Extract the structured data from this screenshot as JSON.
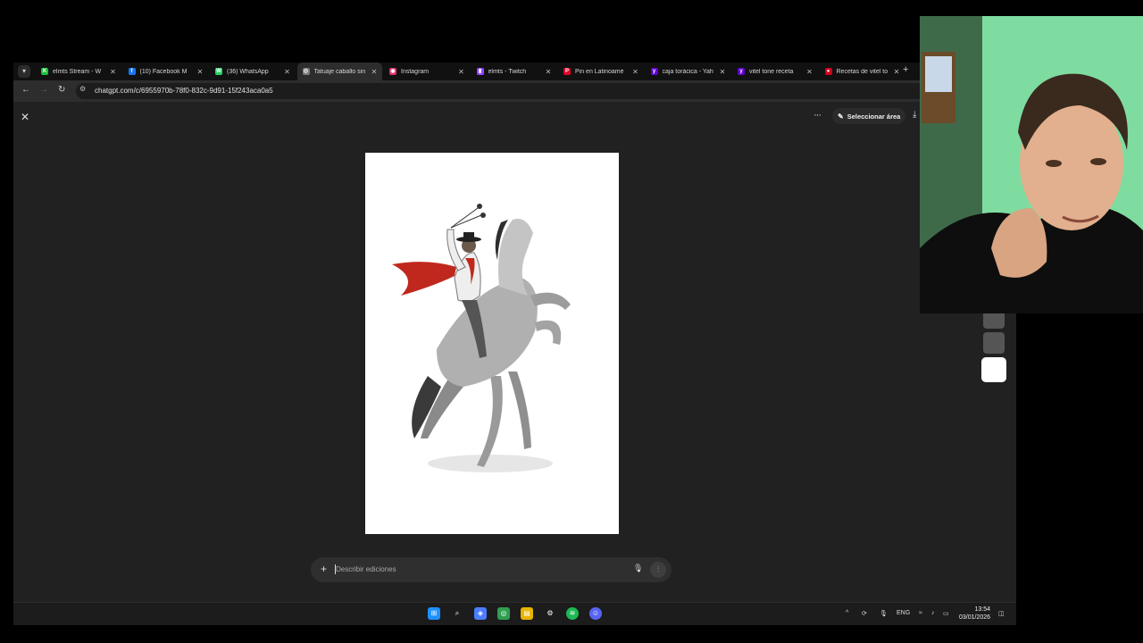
{
  "tabs": [
    {
      "title": "elmts Stream - W",
      "color": "#1fbf3a",
      "glyph": "K"
    },
    {
      "title": "(10) Facebook M",
      "color": "#1877f2",
      "glyph": "f"
    },
    {
      "title": "(36) WhatsApp",
      "color": "#25d366",
      "glyph": "W"
    },
    {
      "title": "Tatuaje caballo sin",
      "color": "#7a7a7a",
      "glyph": "◎"
    },
    {
      "title": "Instagram",
      "color": "#e1306c",
      "glyph": "◉"
    },
    {
      "title": "elmts - Twitch",
      "color": "#9146ff",
      "glyph": "▮"
    },
    {
      "title": "Pin en Latinoamé",
      "color": "#e60023",
      "glyph": "P"
    },
    {
      "title": "caja torácica - Yah",
      "color": "#6001d2",
      "glyph": "y"
    },
    {
      "title": "vitel tone receta",
      "color": "#6001d2",
      "glyph": "y"
    },
    {
      "title": "Recetas de vitel to",
      "color": "#d0021b",
      "glyph": "●"
    }
  ],
  "address": {
    "url": "chatgpt.com/c/6955970b-78f0-832c-9d91-15f243aca0a5"
  },
  "viewer": {
    "select_area_label": "Seleccionar área",
    "more_glyph": "···",
    "close_glyph": "✕"
  },
  "composer": {
    "placeholder": "Describir ediciones"
  },
  "taskbar": {
    "language": "ENG",
    "time": "13:54",
    "date": "03/01/2026"
  },
  "colors": {
    "accent_red": "#c0281e",
    "background": "#212121"
  }
}
